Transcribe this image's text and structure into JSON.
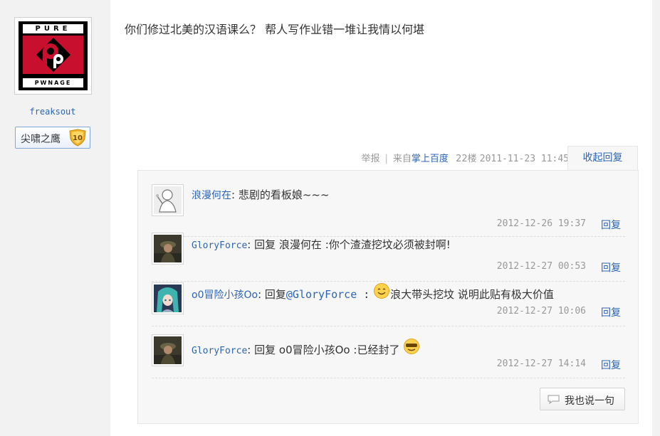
{
  "author": {
    "name": "freaksout",
    "logo_text_top": "PURE",
    "logo_text_bottom": "PWNAGE",
    "level_title": "尖啸之鹰",
    "level": "10"
  },
  "post": {
    "text": "你们修过北美的汉语课么？  帮人写作业错一堆让我情以何堪",
    "report_label": "举报",
    "source_prefix": "来自",
    "source_link": "掌上百度",
    "floor": "22楼",
    "timestamp": "2011-11-23 11:45",
    "collapse_label": "收起回复"
  },
  "replies": [
    {
      "user": "浪漫何在",
      "body": "悲剧的看板娘~~~",
      "time": "2012-12-26 19:37",
      "reply_label": "回复",
      "avatar_icon": "sketch-figure-avatar"
    },
    {
      "user": "GloryForce",
      "prefix": "回复",
      "mention": "浪漫何在",
      "body": " :你个渣渣挖坟必须被封啊!",
      "time": "2012-12-27 00:53",
      "reply_label": "回复",
      "avatar_icon": "soldier-avatar"
    },
    {
      "user": "o0冒险小孩Oo",
      "prefix": "回复",
      "mention": "@GloryForce",
      "sep": " :",
      "body": "浪大带头挖坟 说明此贴有极大价值",
      "time": "2012-12-27 10:06",
      "reply_label": "回复",
      "avatar_icon": "anime-girl-avatar",
      "emoji": "smile-emoji"
    },
    {
      "user": "GloryForce",
      "prefix": "回复",
      "mention": "o0冒险小孩Oo",
      "body": " :已经封了",
      "time": "2012-12-27 14:14",
      "reply_label": "回复",
      "avatar_icon": "soldier-avatar",
      "emoji": "cool-emoji"
    }
  ],
  "say_button": "我也说一句",
  "colors": {
    "link": "#2d64b3",
    "muted": "#999999",
    "logo_red": "#c8102e",
    "badge_gold": "#f0b429"
  }
}
